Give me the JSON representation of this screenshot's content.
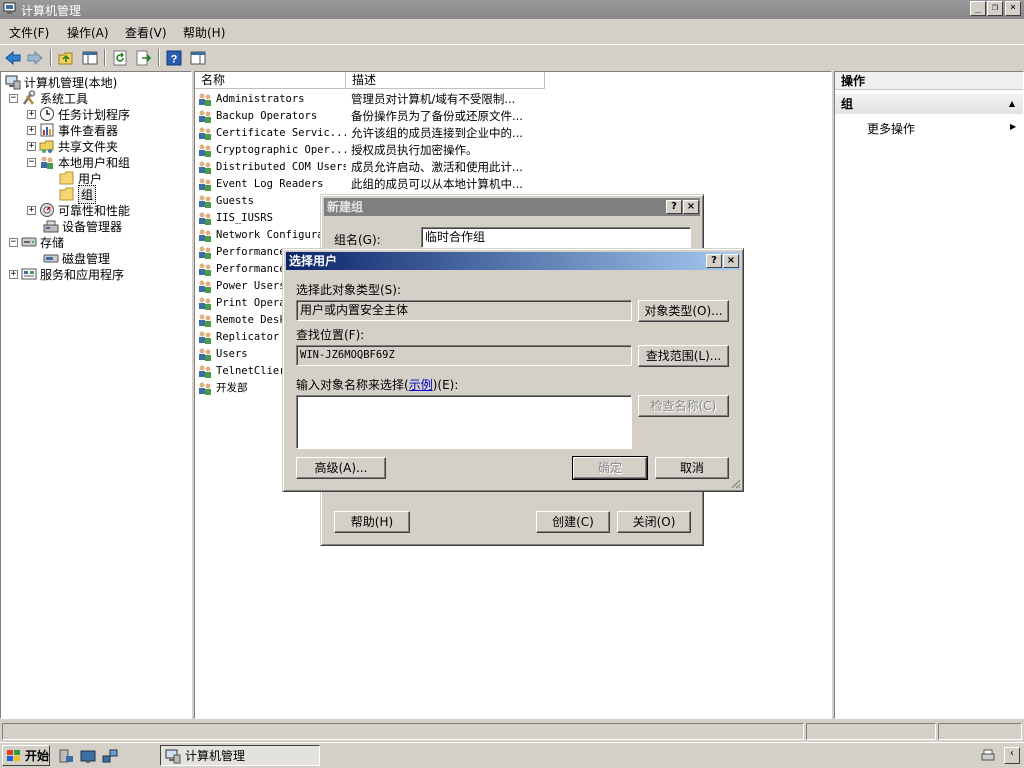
{
  "window": {
    "title": "计算机管理"
  },
  "menu": [
    "文件(F)",
    "操作(A)",
    "查看(V)",
    "帮助(H)"
  ],
  "tree": [
    {
      "label": "计算机管理(本地)",
      "icon": "computer-management-icon",
      "expander": ""
    },
    {
      "label": "系统工具",
      "icon": "tools-icon",
      "expander": "−"
    },
    {
      "label": "任务计划程序",
      "icon": "clock-icon",
      "expander": "+"
    },
    {
      "label": "事件查看器",
      "icon": "event-viewer-icon",
      "expander": "+"
    },
    {
      "label": "共享文件夹",
      "icon": "shared-folder-icon",
      "expander": "+"
    },
    {
      "label": "本地用户和组",
      "icon": "users-group-icon",
      "expander": "−"
    },
    {
      "label": "用户",
      "icon": "folder-icon",
      "expander": ""
    },
    {
      "label": "组",
      "icon": "folder-icon",
      "expander": ""
    },
    {
      "label": "可靠性和性能",
      "icon": "performance-icon",
      "expander": "+"
    },
    {
      "label": "设备管理器",
      "icon": "device-manager-icon",
      "expander": ""
    },
    {
      "label": "存储",
      "icon": "storage-icon",
      "expander": "−"
    },
    {
      "label": "磁盘管理",
      "icon": "disk-management-icon",
      "expander": ""
    },
    {
      "label": "服务和应用程序",
      "icon": "services-icon",
      "expander": "+"
    }
  ],
  "list": {
    "columns": [
      "名称",
      "描述"
    ],
    "rows": [
      {
        "name": "Administrators",
        "desc": "管理员对计算机/域有不受限制..."
      },
      {
        "name": "Backup Operators",
        "desc": "备份操作员为了备份或还原文件..."
      },
      {
        "name": "Certificate Servic...",
        "desc": "允许该组的成员连接到企业中的..."
      },
      {
        "name": "Cryptographic Oper...",
        "desc": "授权成员执行加密操作。"
      },
      {
        "name": "Distributed COM Users",
        "desc": "成员允许启动、激活和使用此计..."
      },
      {
        "name": "Event Log Readers",
        "desc": "此组的成员可以从本地计算机中..."
      },
      {
        "name": "Guests",
        "desc": ""
      },
      {
        "name": "IIS_IUSRS",
        "desc": ""
      },
      {
        "name": "Network Configura",
        "desc": ""
      },
      {
        "name": "Performance",
        "desc": ""
      },
      {
        "name": "Performance",
        "desc": ""
      },
      {
        "name": "Power Users",
        "desc": ""
      },
      {
        "name": "Print Opera",
        "desc": ""
      },
      {
        "name": "Remote Desk",
        "desc": ""
      },
      {
        "name": "Replicator",
        "desc": ""
      },
      {
        "name": "Users",
        "desc": ""
      },
      {
        "name": "TelnetClier",
        "desc": ""
      },
      {
        "name": "开发部",
        "desc": ""
      }
    ]
  },
  "actions": {
    "title": "操作",
    "group": "组",
    "more": "更多操作"
  },
  "new_group": {
    "title": "新建组",
    "name_label": "组名(G):",
    "name_value": "临时合作组",
    "help": "帮助(H)",
    "create": "创建(C)",
    "close": "关闭(O)"
  },
  "select_users": {
    "title": "选择用户",
    "type_label": "选择此对象类型(S):",
    "type_value": "用户或内置安全主体",
    "type_button": "对象类型(O)...",
    "location_label": "查找位置(F):",
    "location_value": "WIN-JZ6MOQBF69Z",
    "location_button": "查找范围(L)...",
    "enter_label_pre": "输入对象名称来选择(",
    "enter_label_link": "示例",
    "enter_label_post": ")(E):",
    "check_names": "检查名称(C)",
    "advanced": "高级(A)...",
    "ok": "确定",
    "cancel": "取消"
  },
  "taskbar": {
    "start": "开始",
    "task": "计算机管理"
  },
  "colors": {
    "title_active": "#0a246a",
    "title_inactive": "#808080"
  }
}
